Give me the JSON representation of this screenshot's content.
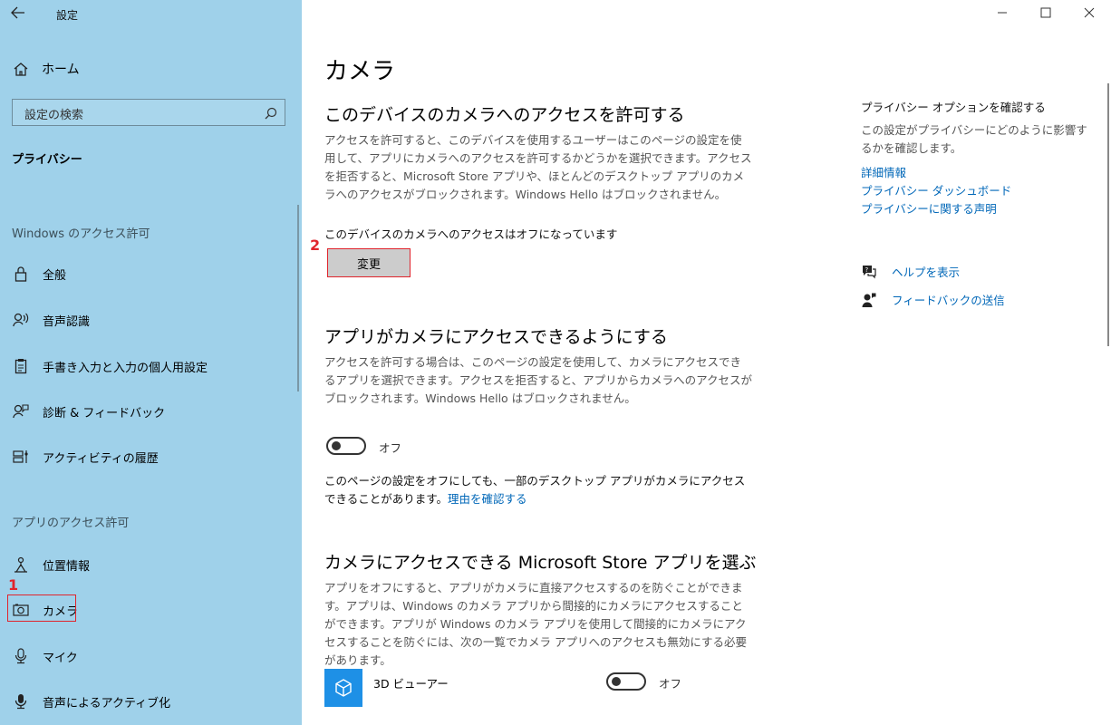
{
  "window": {
    "title": "設定",
    "back_icon": "arrow-left-icon"
  },
  "sidebar": {
    "home_label": "ホーム",
    "search_placeholder": "設定の検索",
    "category": "プライバシー",
    "section_windows": "Windows のアクセス許可",
    "section_apps": "アプリのアクセス許可",
    "items": [
      {
        "label": "全般",
        "icon": "lock-icon"
      },
      {
        "label": "音声認識",
        "icon": "speech-icon"
      },
      {
        "label": "手書き入力と入力の個人用設定",
        "icon": "clipboard-icon"
      },
      {
        "label": "診断 & フィードバック",
        "icon": "person-feedback-icon"
      },
      {
        "label": "アクティビティの履歴",
        "icon": "timeline-icon"
      },
      {
        "label": "位置情報",
        "icon": "location-icon"
      },
      {
        "label": "カメラ",
        "icon": "camera-icon",
        "selected": true
      },
      {
        "label": "マイク",
        "icon": "microphone-icon"
      },
      {
        "label": "音声によるアクティブ化",
        "icon": "voice-activation-icon"
      }
    ]
  },
  "annotations": {
    "marker1": "1",
    "marker2": "2"
  },
  "main": {
    "title": "カメラ",
    "device_section": {
      "heading": "このデバイスのカメラへのアクセスを許可する",
      "description": "アクセスを許可すると、このデバイスを使用するユーザーはこのページの設定を使用して、アプリにカメラへのアクセスを許可するかどうかを選択できます。アクセスを拒否すると、Microsoft Store アプリや、ほとんどのデスクトップ アプリのカメラへのアクセスがブロックされます。Windows Hello はブロックされません。",
      "status": "このデバイスのカメラへのアクセスはオフになっています",
      "change_button": "変更"
    },
    "app_section": {
      "heading": "アプリがカメラにアクセスできるようにする",
      "description": "アクセスを許可する場合は、このページの設定を使用して、カメラにアクセスできるアプリを選択できます。アクセスを拒否すると、アプリからカメラへのアクセスがブロックされます。Windows Hello はブロックされません。",
      "toggle_label": "オフ",
      "note": "このページの設定をオフにしても、一部のデスクトップ アプリがカメラにアクセスできることがあります。",
      "note_link": "理由を確認する"
    },
    "store_section": {
      "heading": "カメラにアクセスできる Microsoft Store アプリを選ぶ",
      "description": "アプリをオフにすると、アプリがカメラに直接アクセスするのを防ぐことができます。アプリは、Windows のカメラ アプリから間接的にカメラにアクセスすることができます。アプリが Windows のカメラ アプリを使用して間接的にカメラにアクセスすることを防ぐには、次の一覧でカメラ アプリへのアクセスも無効にする必要があります。",
      "apps": [
        {
          "name": "3D ビューアー",
          "toggle_label": "オフ",
          "icon": "cube-icon"
        }
      ]
    }
  },
  "right": {
    "title": "プライバシー オプションを確認する",
    "text": "この設定がプライバシーにどのように影響するかを確認します。",
    "links": [
      "詳細情報",
      "プライバシー ダッシュボード",
      "プライバシーに関する声明"
    ],
    "help": "ヘルプを表示",
    "feedback": "フィードバックの送信"
  }
}
